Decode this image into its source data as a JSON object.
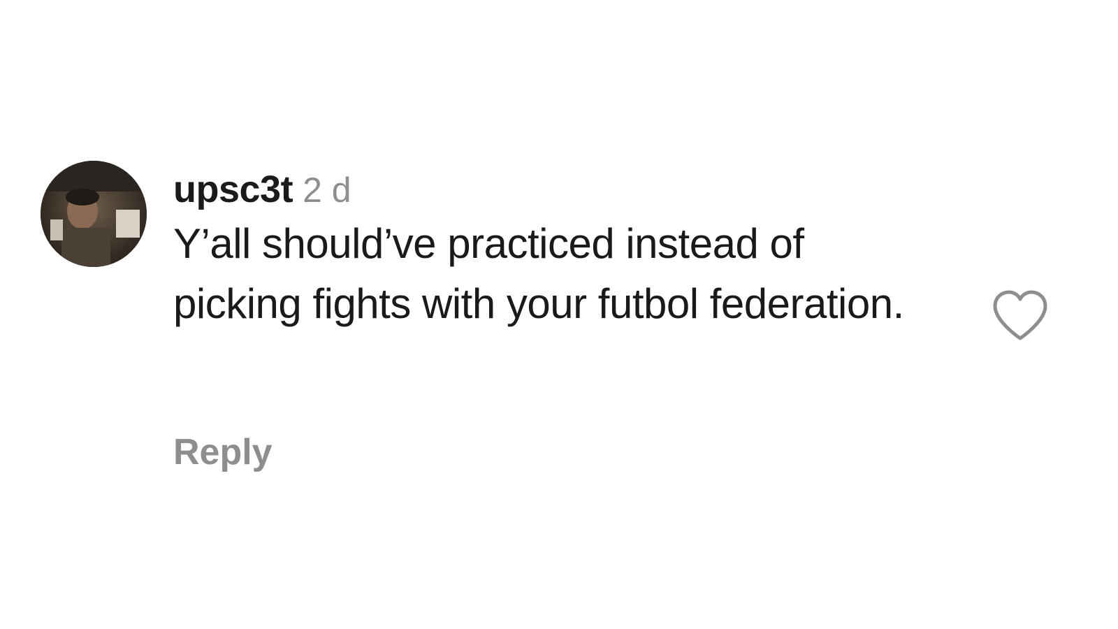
{
  "comment": {
    "username": "upsc3t",
    "timestamp": "2 d",
    "text": "Y’all should’ve practiced instead of picking fights with your futbol federation.",
    "reply_label": "Reply",
    "avatar_icon": "user-avatar-photo",
    "like_icon": "heart-outline-icon"
  },
  "colors": {
    "text": "#1a1a1a",
    "muted": "#8e8e8e",
    "background": "#ffffff"
  }
}
